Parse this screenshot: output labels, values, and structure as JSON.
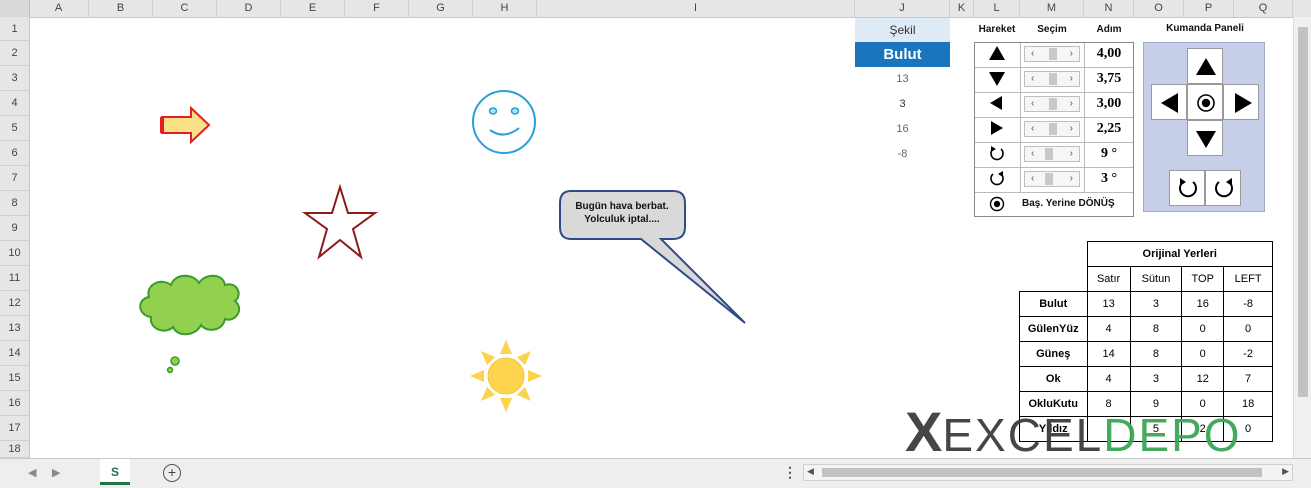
{
  "columns": [
    "A",
    "B",
    "C",
    "D",
    "E",
    "F",
    "G",
    "H",
    "I",
    "J",
    "K",
    "L",
    "M",
    "N",
    "O",
    "P",
    "Q"
  ],
  "rows": [
    "1",
    "2",
    "3",
    "4",
    "5",
    "6",
    "7",
    "8",
    "9",
    "10",
    "11",
    "12",
    "13",
    "14",
    "15",
    "16",
    "17",
    "18"
  ],
  "sheet_tab": "S",
  "sekil": {
    "label": "Şekil",
    "selected": "Bulut",
    "values": [
      "13",
      "3",
      "16",
      "-8"
    ]
  },
  "panel_headers": {
    "hareket": "Hareket",
    "secim": "Seçim",
    "adim": "Adım",
    "kumanda": "Kumanda Paneli"
  },
  "steps": [
    "4,00",
    "3,75",
    "3,00",
    "2,25",
    "9 °",
    "3 °"
  ],
  "reset_label": "Baş. Yerine DÖNÜŞ",
  "callout": {
    "line1": "Bugün hava berbat.",
    "line2": "Yolculuk iptal...."
  },
  "orig": {
    "title": "Orijinal Yerleri",
    "headers": [
      "Satır",
      "Sütun",
      "TOP",
      "LEFT"
    ],
    "rows": [
      {
        "name": "Bulut",
        "values": [
          "13",
          "3",
          "16",
          "-8"
        ]
      },
      {
        "name": "GülenYüz",
        "values": [
          "4",
          "8",
          "0",
          "0"
        ]
      },
      {
        "name": "Güneş",
        "values": [
          "14",
          "8",
          "0",
          "-2"
        ]
      },
      {
        "name": "Ok",
        "values": [
          "4",
          "3",
          "12",
          "7"
        ]
      },
      {
        "name": "OkluKutu",
        "values": [
          "8",
          "9",
          "0",
          "18"
        ]
      },
      {
        "name": "Yıldız",
        "values": [
          "",
          "5",
          "2",
          "0"
        ]
      }
    ]
  },
  "watermark": {
    "x": "X",
    "excel": "EXCEL",
    "depo": "DEPO"
  },
  "colors": {
    "accent": "#1b75bc",
    "excel_green": "#217346",
    "panel": "#c7cfe8",
    "depo": "#3aa655"
  }
}
